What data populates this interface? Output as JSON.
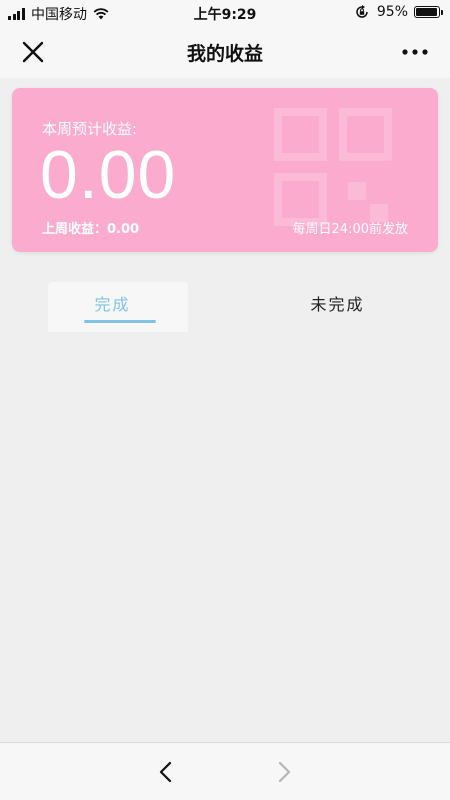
{
  "status_bar": {
    "carrier": "中国移动",
    "time": "上午9:29",
    "battery_percent": "95%",
    "battery_level": 0.95,
    "icons": [
      "signal-icon",
      "wifi-icon",
      "rotation-lock-icon",
      "battery-icon"
    ]
  },
  "nav": {
    "title": "我的收益",
    "close_icon": "close-icon",
    "more_icon": "more-icon"
  },
  "earnings_card": {
    "label": "本周预计收益:",
    "amount": "0.00",
    "last_week": "上周收益：0.00",
    "payout_note": "每周日24:00前发放",
    "background_color": "#fbabcd"
  },
  "tabs": {
    "items": [
      {
        "label": "完成",
        "active": true
      },
      {
        "label": "未完成",
        "active": false
      }
    ],
    "active_color": "#7fc4e6"
  },
  "bottom_bar": {
    "back_icon": "chevron-left-icon",
    "forward_icon": "chevron-right-icon",
    "forward_enabled": false
  }
}
